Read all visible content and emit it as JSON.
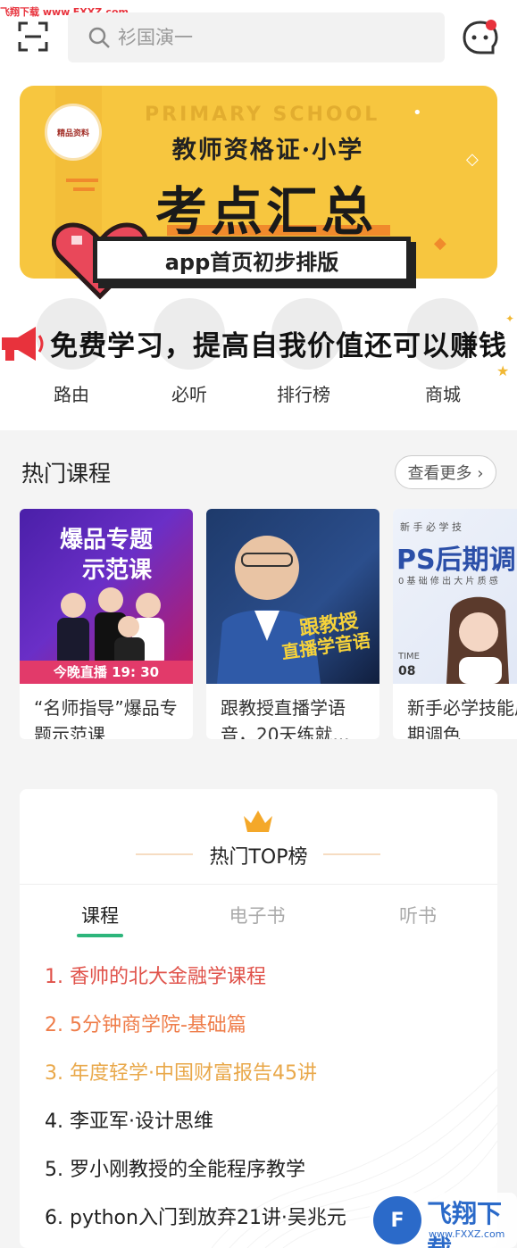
{
  "watermark_top": "飞翔下载 www.FXXZ.com",
  "search": {
    "placeholder": "衫国演一"
  },
  "banner": {
    "badge": "精品资料",
    "english": "PRIMARY SCHOOL",
    "subtitle": "教师资格证·小学",
    "main": "考点汇总",
    "pill": "app首页初步排版"
  },
  "promo": {
    "text": "免费学习，提高自我价值还可以赚钱"
  },
  "nav": [
    {
      "label": "路由"
    },
    {
      "label": "必听"
    },
    {
      "label": "排行榜"
    },
    {
      "label": "商城"
    }
  ],
  "hot_courses": {
    "title": "热门课程",
    "more": "查看更多 ›",
    "items": [
      {
        "title": "“名师指导”爆品专题示范课",
        "thumb_head": "爆品专题",
        "thumb_head2": "示范课",
        "thumb_footer": "今晚直播 19: 30"
      },
      {
        "title": "跟教授直播学语音，20天练就...",
        "thumb_head": "跟教授",
        "thumb_head2": "直播学音语"
      },
      {
        "title": "新手必学技能后期调色",
        "thumb_tag": "新 手 必 学 技",
        "thumb_head": "PS后期调",
        "thumb_sub": "0 基 础 修 出 大 片 质 感",
        "thumb_time": "TIME",
        "thumb_date": "08"
      }
    ]
  },
  "top_list": {
    "title": "热门TOP榜",
    "tabs": [
      {
        "label": "课程"
      },
      {
        "label": "电子书"
      },
      {
        "label": "听书"
      }
    ],
    "items": [
      {
        "text": "1. 香帅的北大金融学课程",
        "color": "#e0524a"
      },
      {
        "text": "2. 5分钟商学院-基础篇",
        "color": "#ef7d4a"
      },
      {
        "text": "3. 年度轻学·中国财富报告45讲",
        "color": "#e9a84a"
      },
      {
        "text": "4. 李亚军·设计思维",
        "color": "#222222"
      },
      {
        "text": "5. 罗小刚教授的全能程序教学",
        "color": "#222222"
      },
      {
        "text": "6. python入门到放弃21讲·吴兆元",
        "color": "#222222"
      }
    ]
  },
  "logo_watermark": {
    "mark": "F",
    "text": "飞翔下载",
    "url": "www.FXXZ.com"
  },
  "colors": {
    "accent_green": "#2db57b",
    "banner_yellow": "#f7c63f",
    "badge_red": "#e8323c"
  }
}
